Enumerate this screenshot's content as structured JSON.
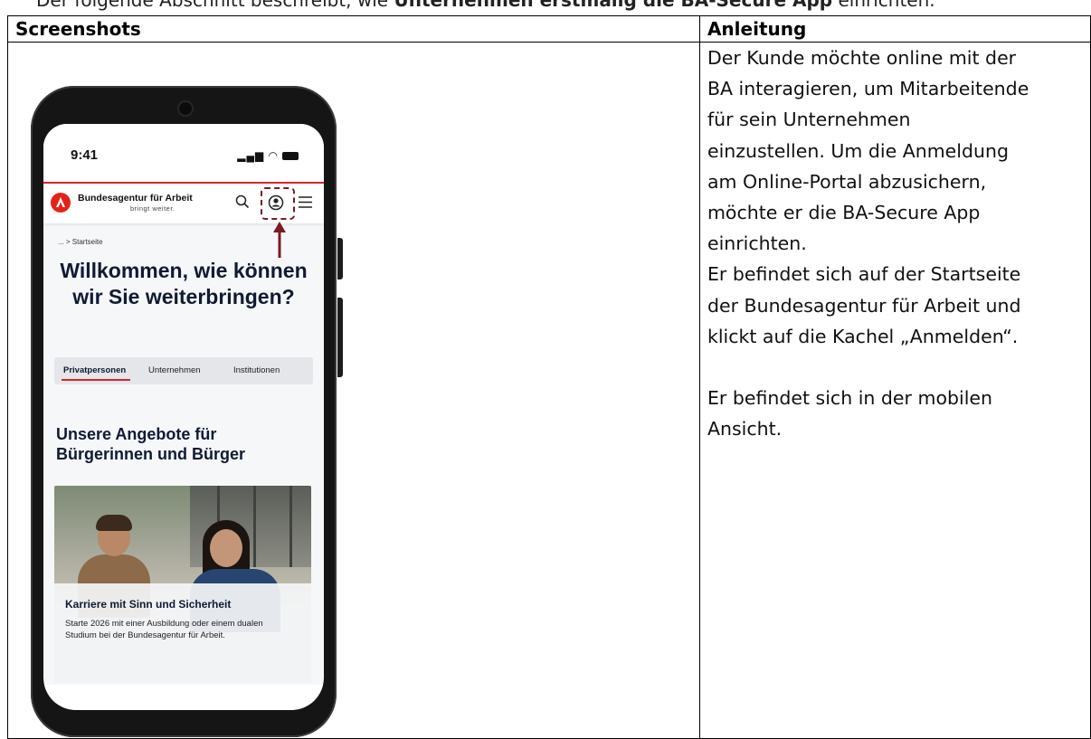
{
  "top_strip": {
    "text_pre": "Der folgende Abschnitt beschreibt, wie ",
    "text_bold": "Unternehmen erstmalig die BA-Secure App",
    "text_post": " einrichten."
  },
  "table": {
    "header_left": "Screenshots",
    "header_right": "Anleitung",
    "instructions": [
      "Der Kunde möchte online mit der",
      "BA interagieren, um Mitarbeitende",
      "für sein Unternehmen",
      "einzustellen. Um die Anmeldung",
      "am Online-Portal abzusichern,",
      "möchte er die BA-Secure App",
      "einrichten.",
      "Er befindet sich auf der Startseite",
      "der Bundesagentur für Arbeit und",
      "klickt auf die Kachel „Anmelden“."
    ],
    "instructions_2": [
      "Er befindet sich in der mobilen",
      "Ansicht."
    ]
  },
  "phone": {
    "time": "9:41",
    "brand_name": "Bundesagentur für Arbeit",
    "brand_tagline": "bringt weiter.",
    "breadcrumb": "... > Startseite",
    "hero_line1": "Willkommen, wie können",
    "hero_line2": "wir Sie weiterbringen?",
    "tabs": [
      "Privatpersonen",
      "Unternehmen",
      "Institutionen"
    ],
    "active_tab": "Privatpersonen",
    "section_line1": "Unsere Angebote für",
    "section_line2": "Bürgerinnen und Bürger",
    "card_title": "Karriere mit Sinn und Sicherheit",
    "card_text": "Starte 2026 mit einer Ausbildung oder einem dualen Studium bei der Bundesagentur für Arbeit.",
    "highlight_color": "#7a1b24",
    "accent_color": "#d3262b",
    "icons": [
      "search-icon",
      "user-account-icon",
      "menu-icon",
      "arrow-up-icon"
    ]
  }
}
